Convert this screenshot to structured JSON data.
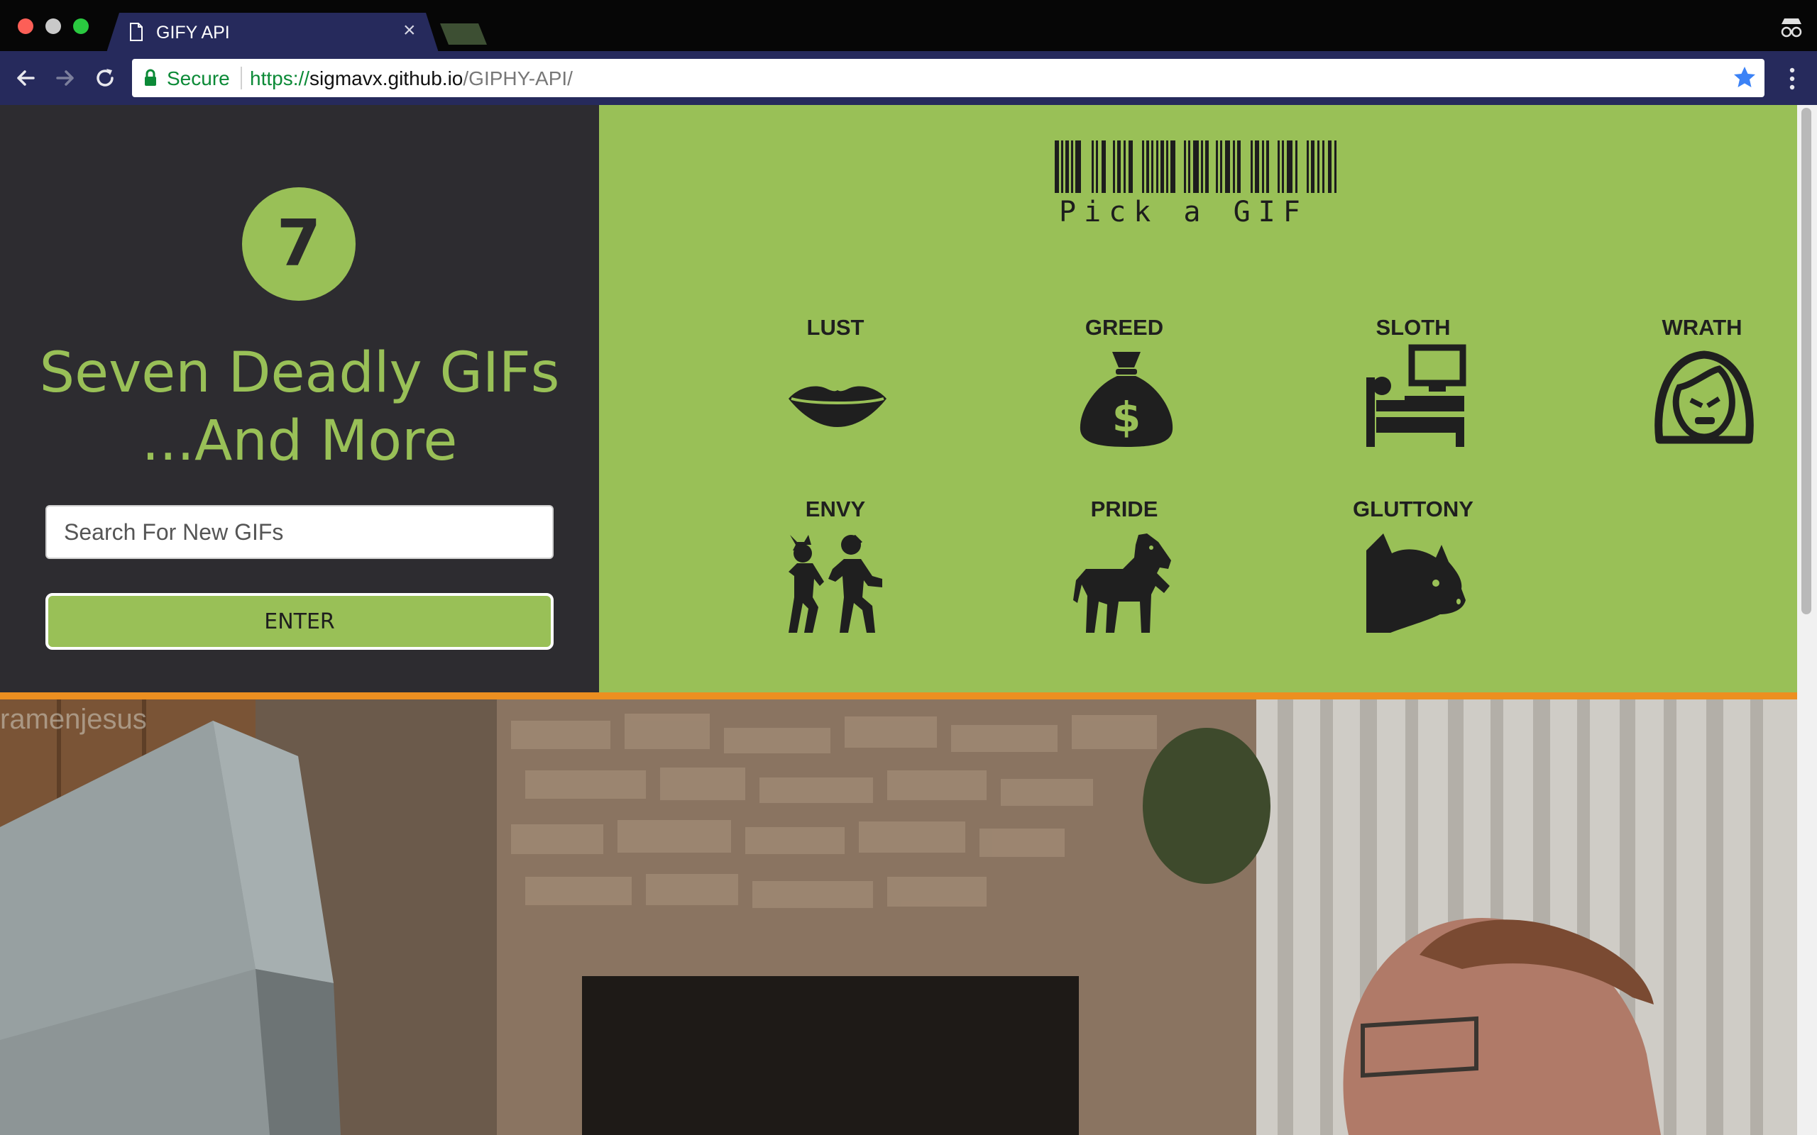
{
  "browser": {
    "tab_title": "GIFY API",
    "tab_close": "×",
    "secure_label": "Secure",
    "url_scheme": "https://",
    "url_host": "sigmavx.github.io",
    "url_path": "/GIPHY-API/"
  },
  "left_panel": {
    "badge_number": "7",
    "headline_line1": "Seven Deadly GIFs",
    "headline_line2": "...And More",
    "search_placeholder": "Search For New GIFs",
    "enter_label": "ENTER"
  },
  "right_panel": {
    "barcode_caption": "Pick a GIF",
    "sins": [
      {
        "label": "LUST",
        "icon": "lips-icon"
      },
      {
        "label": "GREED",
        "icon": "money-bag-icon"
      },
      {
        "label": "SLOTH",
        "icon": "bed-tv-icon"
      },
      {
        "label": "WRATH",
        "icon": "angry-face-icon"
      },
      {
        "label": "ENVY",
        "icon": "dancing-people-icon"
      },
      {
        "label": "PRIDE",
        "icon": "horse-icon"
      },
      {
        "label": "GLUTTONY",
        "icon": "pig-icon"
      }
    ]
  },
  "gif": {
    "watermark": "ramenjesus"
  },
  "colors": {
    "accent_green": "#99c057",
    "panel_dark": "#2d2c30",
    "divider_orange": "#ec8f20",
    "browser_navy": "#262a5c"
  }
}
